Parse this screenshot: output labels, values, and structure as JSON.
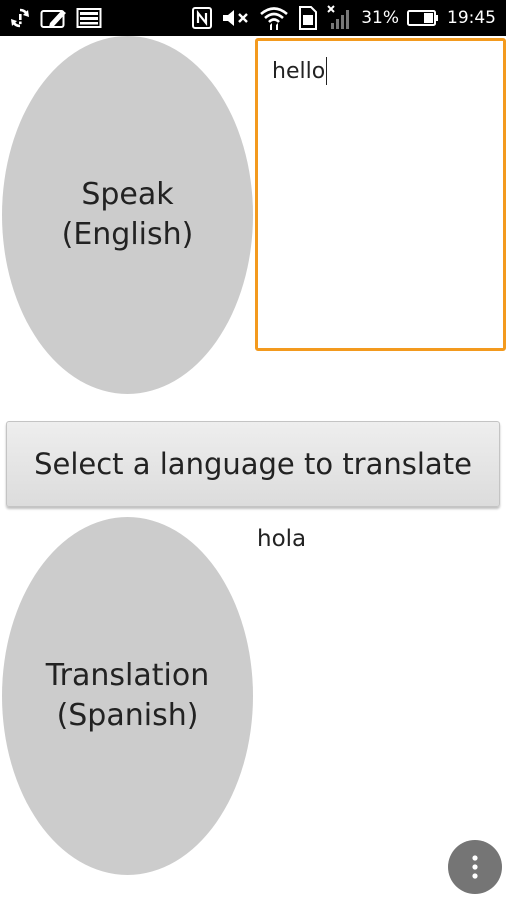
{
  "status_bar": {
    "battery_percent": "31%",
    "time": "19:45",
    "icons": [
      "sync-icon",
      "edit-icon",
      "image-icon",
      "nfc-icon",
      "mute-icon",
      "wifi-icon",
      "sim-icon",
      "signal-icon",
      "battery-icon"
    ]
  },
  "speak": {
    "line1": "Speak",
    "line2": "(English)"
  },
  "input": {
    "value": "hello"
  },
  "language_button": {
    "label": "Select a language to translate"
  },
  "translation": {
    "line1": "Translation",
    "line2": "(Spanish)",
    "result": "hola"
  },
  "colors": {
    "oval": "#cccccc",
    "input_border": "#f39a1e",
    "fab": "#757575"
  },
  "overflow": {
    "icon": "more-vert-icon"
  }
}
